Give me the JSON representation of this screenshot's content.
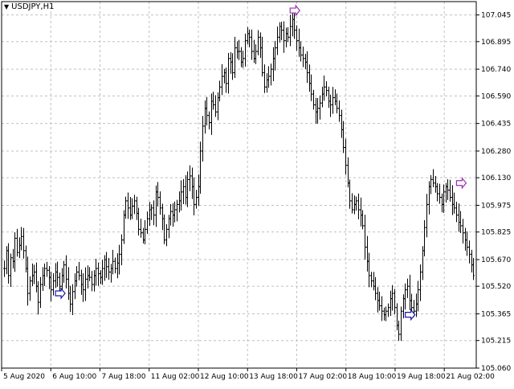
{
  "window": {
    "symbol_label": "USDJPY,H1"
  },
  "chart_data": {
    "type": "bar",
    "subtype": "ohlc-bars",
    "symbol": "USDJPY",
    "timeframe": "H1",
    "grid": true,
    "grid_style": "dashed",
    "ylim": [
      105.06,
      107.12
    ],
    "y_ticks": [
      "107.045",
      "106.895",
      "106.740",
      "106.590",
      "106.435",
      "106.280",
      "106.130",
      "105.975",
      "105.825",
      "105.670",
      "105.520",
      "105.365",
      "105.215",
      "105.060"
    ],
    "x_ticks": [
      "5 Aug 2020",
      "6 Aug 10:00",
      "7 Aug 18:00",
      "11 Aug 02:00",
      "12 Aug 10:00",
      "13 Aug 18:00",
      "17 Aug 02:00",
      "18 Aug 10:00",
      "19 Aug 18:00",
      "21 Aug 02:00"
    ],
    "series": [
      {
        "values": [
          105.62,
          105.72,
          105.58,
          105.68,
          105.66,
          105.79,
          105.71,
          105.75,
          105.8,
          105.72,
          105.62,
          105.48,
          105.55,
          105.58,
          105.6,
          105.52,
          105.43,
          105.53,
          105.58,
          105.62,
          105.61,
          105.57,
          105.5,
          105.55,
          105.6,
          105.57,
          105.52,
          105.58,
          105.64,
          105.56,
          105.48,
          105.42,
          105.49,
          105.55,
          105.6,
          105.58,
          105.53,
          105.5,
          105.56,
          105.58,
          105.57,
          105.53,
          105.58,
          105.62,
          105.59,
          105.57,
          105.62,
          105.67,
          105.63,
          105.6,
          105.62,
          105.66,
          105.62,
          105.65,
          105.7,
          105.78,
          105.92,
          106.0,
          105.96,
          105.92,
          105.97,
          106.0,
          105.93,
          105.84,
          105.82,
          105.78,
          105.84,
          105.9,
          105.95,
          105.96,
          105.92,
          106.05,
          106.02,
          105.96,
          105.9,
          105.78,
          105.84,
          105.9,
          105.94,
          105.92,
          105.95,
          105.98,
          106.0,
          106.05,
          106.08,
          106.02,
          106.12,
          106.14,
          106.08,
          105.98,
          106.02,
          106.08,
          106.28,
          106.42,
          106.52,
          106.48,
          106.44,
          106.56,
          106.54,
          106.5,
          106.58,
          106.64,
          106.7,
          106.72,
          106.66,
          106.8,
          106.78,
          106.72,
          106.86,
          106.84,
          106.84,
          106.78,
          106.8,
          106.9,
          106.94,
          106.92,
          106.84,
          106.8,
          106.84,
          106.92,
          106.86,
          106.72,
          106.64,
          106.68,
          106.7,
          106.74,
          106.8,
          106.86,
          106.92,
          106.98,
          106.96,
          106.9,
          106.94,
          106.92,
          106.98,
          107.02,
          106.96,
          106.9,
          106.86,
          106.82,
          106.8,
          106.78,
          106.72,
          106.66,
          106.6,
          106.54,
          106.5,
          106.52,
          106.55,
          106.6,
          106.64,
          106.62,
          106.56,
          106.54,
          106.58,
          106.56,
          106.52,
          106.48,
          106.4,
          106.3,
          106.2,
          106.1,
          106.0,
          105.95,
          105.98,
          106.0,
          105.95,
          105.92,
          105.86,
          105.74,
          105.66,
          105.58,
          105.55,
          105.52,
          105.48,
          105.44,
          105.41,
          105.38,
          105.36,
          105.38,
          105.4,
          105.45,
          105.48,
          105.4,
          105.3,
          105.25,
          105.38,
          105.45,
          105.5,
          105.52,
          105.44,
          105.4,
          105.38,
          105.42,
          105.5,
          105.6,
          105.72,
          105.85,
          105.98,
          106.08,
          106.12,
          106.1,
          106.08,
          106.04,
          106.02,
          105.98,
          106.05,
          106.08,
          106.06,
          106.02,
          105.98,
          105.96,
          105.92,
          105.88,
          105.86,
          105.82,
          105.78,
          105.74,
          105.7,
          105.64,
          105.58
        ]
      }
    ],
    "annotations": [
      {
        "type": "arrow-marker",
        "x_index": 26,
        "price": 105.48,
        "color": "#1a1aa8"
      },
      {
        "type": "arrow-marker",
        "x_index": 136,
        "price": 107.07,
        "color": "#9b2fb0"
      },
      {
        "type": "arrow-marker",
        "x_index": 190,
        "price": 105.36,
        "color": "#1a1aa8"
      },
      {
        "type": "arrow-marker",
        "x_index": 214,
        "price": 106.1,
        "color": "#9b2fb0"
      }
    ],
    "colors": {
      "bars": "#000000",
      "grid": "#c0c0c0",
      "axis": "#000000",
      "background": "#ffffff"
    }
  }
}
